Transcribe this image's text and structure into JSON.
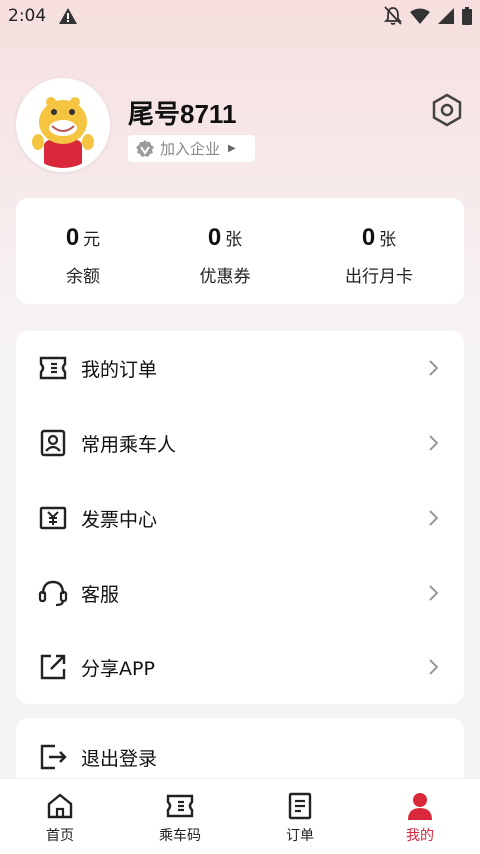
{
  "status_bar": {
    "time": "2:04"
  },
  "profile": {
    "username": "尾号8711",
    "join_company": "加入企业"
  },
  "stats": [
    {
      "value": "0",
      "unit": "元",
      "label": "余额"
    },
    {
      "value": "0",
      "unit": "张",
      "label": "优惠券"
    },
    {
      "value": "0",
      "unit": "张",
      "label": "出行月卡"
    }
  ],
  "menu": [
    {
      "label": "我的订单",
      "icon": "ticket-icon"
    },
    {
      "label": "常用乘车人",
      "icon": "person-card-icon"
    },
    {
      "label": "发票中心",
      "icon": "invoice-icon"
    },
    {
      "label": "客服",
      "icon": "headset-icon"
    },
    {
      "label": "分享APP",
      "icon": "share-icon"
    }
  ],
  "logout": {
    "label": "退出登录"
  },
  "bottom_nav": [
    {
      "label": "首页",
      "icon": "home-icon"
    },
    {
      "label": "乘车码",
      "icon": "ticket-code-icon"
    },
    {
      "label": "订单",
      "icon": "order-icon"
    },
    {
      "label": "我的",
      "icon": "user-icon",
      "active": true
    }
  ],
  "colors": {
    "accent": "#d9283a",
    "avatar_bg": "#f5c542"
  }
}
